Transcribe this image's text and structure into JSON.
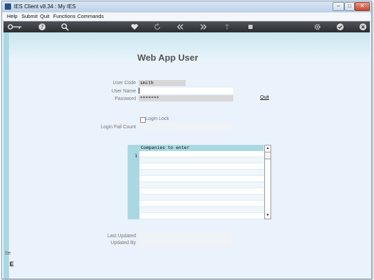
{
  "window": {
    "title": "IES Client v8.34 : My IES"
  },
  "window_buttons": {
    "minimize": "–",
    "maximize": "□",
    "close": "✕"
  },
  "menu": [
    "Help",
    "Submit",
    "Quit",
    "Functions",
    "Commands"
  ],
  "toolbar_icons": [
    "key-icon",
    "help-icon",
    "search-icon",
    "heart-icon",
    "refresh-icon",
    "rewind-icon",
    "fast-forward-icon",
    "upload-icon",
    "stop-icon",
    "settings-icon",
    "check-icon",
    "close-icon"
  ],
  "page": {
    "title": "Web App User"
  },
  "form": {
    "user_code_label": "User Code",
    "user_code_value": "smith",
    "user_name_label": "User Name",
    "user_name_value": "",
    "password_label": "Password",
    "password_value": "*******",
    "quit_link": "Quit",
    "login_lock_label": "Login Lock",
    "login_lock_checked": false,
    "login_fail_count_label": "Login Fail Count",
    "login_fail_count_value": "",
    "last_updated_label": "Last Updated",
    "last_updated_value": "",
    "updated_by_label": "Updated By",
    "updated_by_value": ""
  },
  "grid": {
    "header": "Companies to enter",
    "row_numbers": [
      "1"
    ],
    "rows": [
      "",
      "",
      "",
      "",
      "",
      "",
      "",
      "",
      "",
      "",
      ""
    ]
  },
  "statusbar": {
    "partial_text": "Se",
    "partial_glyph": "E"
  },
  "colors": {
    "accent_cyan": "#a9d8e3",
    "toolbar_dark": "#2a2c30",
    "background": "#eaf2fb"
  }
}
